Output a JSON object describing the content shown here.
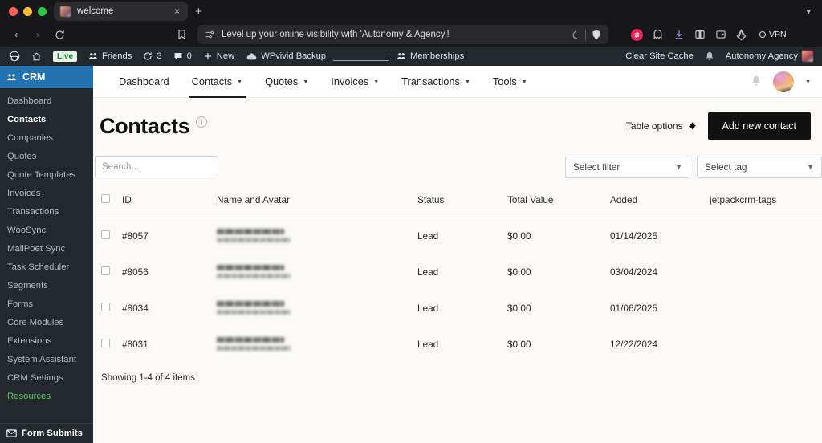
{
  "browser": {
    "tab": {
      "title": "welcome",
      "favicon": "site-favicon",
      "close_label": "×"
    },
    "new_tab_label": "+",
    "tabstrip_menu_icon": "chevron-down-icon",
    "nav": {
      "back": "‹",
      "forward": "›",
      "reload": "↻"
    },
    "address_bar": {
      "text": "Level up your online visibility with 'Autonomy & Agency'!",
      "leading_icon": "page-settings-icon",
      "leo_icon": "brave-leo-icon",
      "shields_icon": "brave-shields-icon"
    },
    "bookmark_icon": "bookmark-icon",
    "extensions": [
      {
        "name": "extension-red-icon",
        "label": ""
      },
      {
        "name": "ghost-extension-icon",
        "label": ""
      },
      {
        "name": "download-icon",
        "label": ""
      },
      {
        "name": "sidebar-toggle-icon",
        "label": ""
      },
      {
        "name": "wallet-icon",
        "label": ""
      },
      {
        "name": "brave-rewards-icon",
        "label": ""
      }
    ],
    "vpn_label": "VPN"
  },
  "adminbar": {
    "wp_logo": "wordpress-logo-icon",
    "site_home_icon": "home-icon",
    "live_badge": "Live",
    "friends_icon": "friends-icon",
    "friends_label": "Friends",
    "updates_icon": "updates-icon",
    "updates_count": "3",
    "comments_icon": "comments-icon",
    "comments_count": "0",
    "new_icon": "plus-icon",
    "new_label": "New",
    "backup_icon": "cloud-icon",
    "backup_label": "WPvivid Backup",
    "memberships_icon": "memberships-icon",
    "memberships_label": "Memberships",
    "clear_cache_label": "Clear Site Cache",
    "notifications_icon": "bell-icon",
    "account_label": "Autonomy Agency",
    "account_avatar": "user-avatar"
  },
  "sidebar": {
    "header": {
      "label": "CRM",
      "icon": "crm-icon",
      "accent": "#2271b1"
    },
    "items": [
      {
        "label": "Dashboard",
        "state": "default"
      },
      {
        "label": "Contacts",
        "state": "active"
      },
      {
        "label": "Companies",
        "state": "default"
      },
      {
        "label": "Quotes",
        "state": "default"
      },
      {
        "label": "Quote Templates",
        "state": "default"
      },
      {
        "label": "Invoices",
        "state": "default"
      },
      {
        "label": "Transactions",
        "state": "default"
      },
      {
        "label": "WooSync",
        "state": "default"
      },
      {
        "label": "MailPoet Sync",
        "state": "default"
      },
      {
        "label": "Task Scheduler",
        "state": "default"
      },
      {
        "label": "Segments",
        "state": "default"
      },
      {
        "label": "Forms",
        "state": "default"
      },
      {
        "label": "Core Modules",
        "state": "default"
      },
      {
        "label": "Extensions",
        "state": "default"
      },
      {
        "label": "System Assistant",
        "state": "default"
      },
      {
        "label": "CRM Settings",
        "state": "default"
      },
      {
        "label": "Resources",
        "state": "highlight"
      }
    ],
    "footer": {
      "label": "Form Submits",
      "icon": "envelope-icon"
    }
  },
  "crm_nav": {
    "items": [
      {
        "label": "Dashboard",
        "has_caret": false,
        "active": false
      },
      {
        "label": "Contacts",
        "has_caret": true,
        "active": true
      },
      {
        "label": "Quotes",
        "has_caret": true,
        "active": false
      },
      {
        "label": "Invoices",
        "has_caret": true,
        "active": false
      },
      {
        "label": "Transactions",
        "has_caret": true,
        "active": false
      },
      {
        "label": "Tools",
        "has_caret": true,
        "active": false
      }
    ],
    "bell_icon": "bell-icon",
    "avatar": "user-avatar",
    "avatar_caret": "chevron-down-icon"
  },
  "page": {
    "title": "Contacts",
    "info_icon": "info-icon",
    "table_options_label": "Table options",
    "table_options_icon": "gear-icon",
    "add_contact_label": "Add new contact"
  },
  "toolbar": {
    "search_placeholder": "Search...",
    "search_value": "",
    "filter_select": {
      "value": "Select filter",
      "chevron": "chevron-down-icon"
    },
    "tag_select": {
      "value": "Select tag",
      "chevron": "chevron-down-icon"
    }
  },
  "table": {
    "columns": [
      "ID",
      "Name and Avatar",
      "Status",
      "Total Value",
      "Added",
      "jetpackcrm-tags"
    ],
    "rows": [
      {
        "id": "#8057",
        "name": "redacted",
        "email": "redacted",
        "status": "Lead",
        "total_value": "$0.00",
        "added": "01/14/2025",
        "tags": ""
      },
      {
        "id": "#8056",
        "name": "redacted",
        "email": "redacted",
        "status": "Lead",
        "total_value": "$0.00",
        "added": "03/04/2024",
        "tags": ""
      },
      {
        "id": "#8034",
        "name": "redacted",
        "email": "redacted",
        "status": "Lead",
        "total_value": "$0.00",
        "added": "01/06/2025",
        "tags": ""
      },
      {
        "id": "#8031",
        "name": "redacted",
        "email": "redacted",
        "status": "Lead",
        "total_value": "$0.00",
        "added": "12/22/2024",
        "tags": ""
      }
    ],
    "showing_text": "Showing 1-4 of 4 items"
  }
}
